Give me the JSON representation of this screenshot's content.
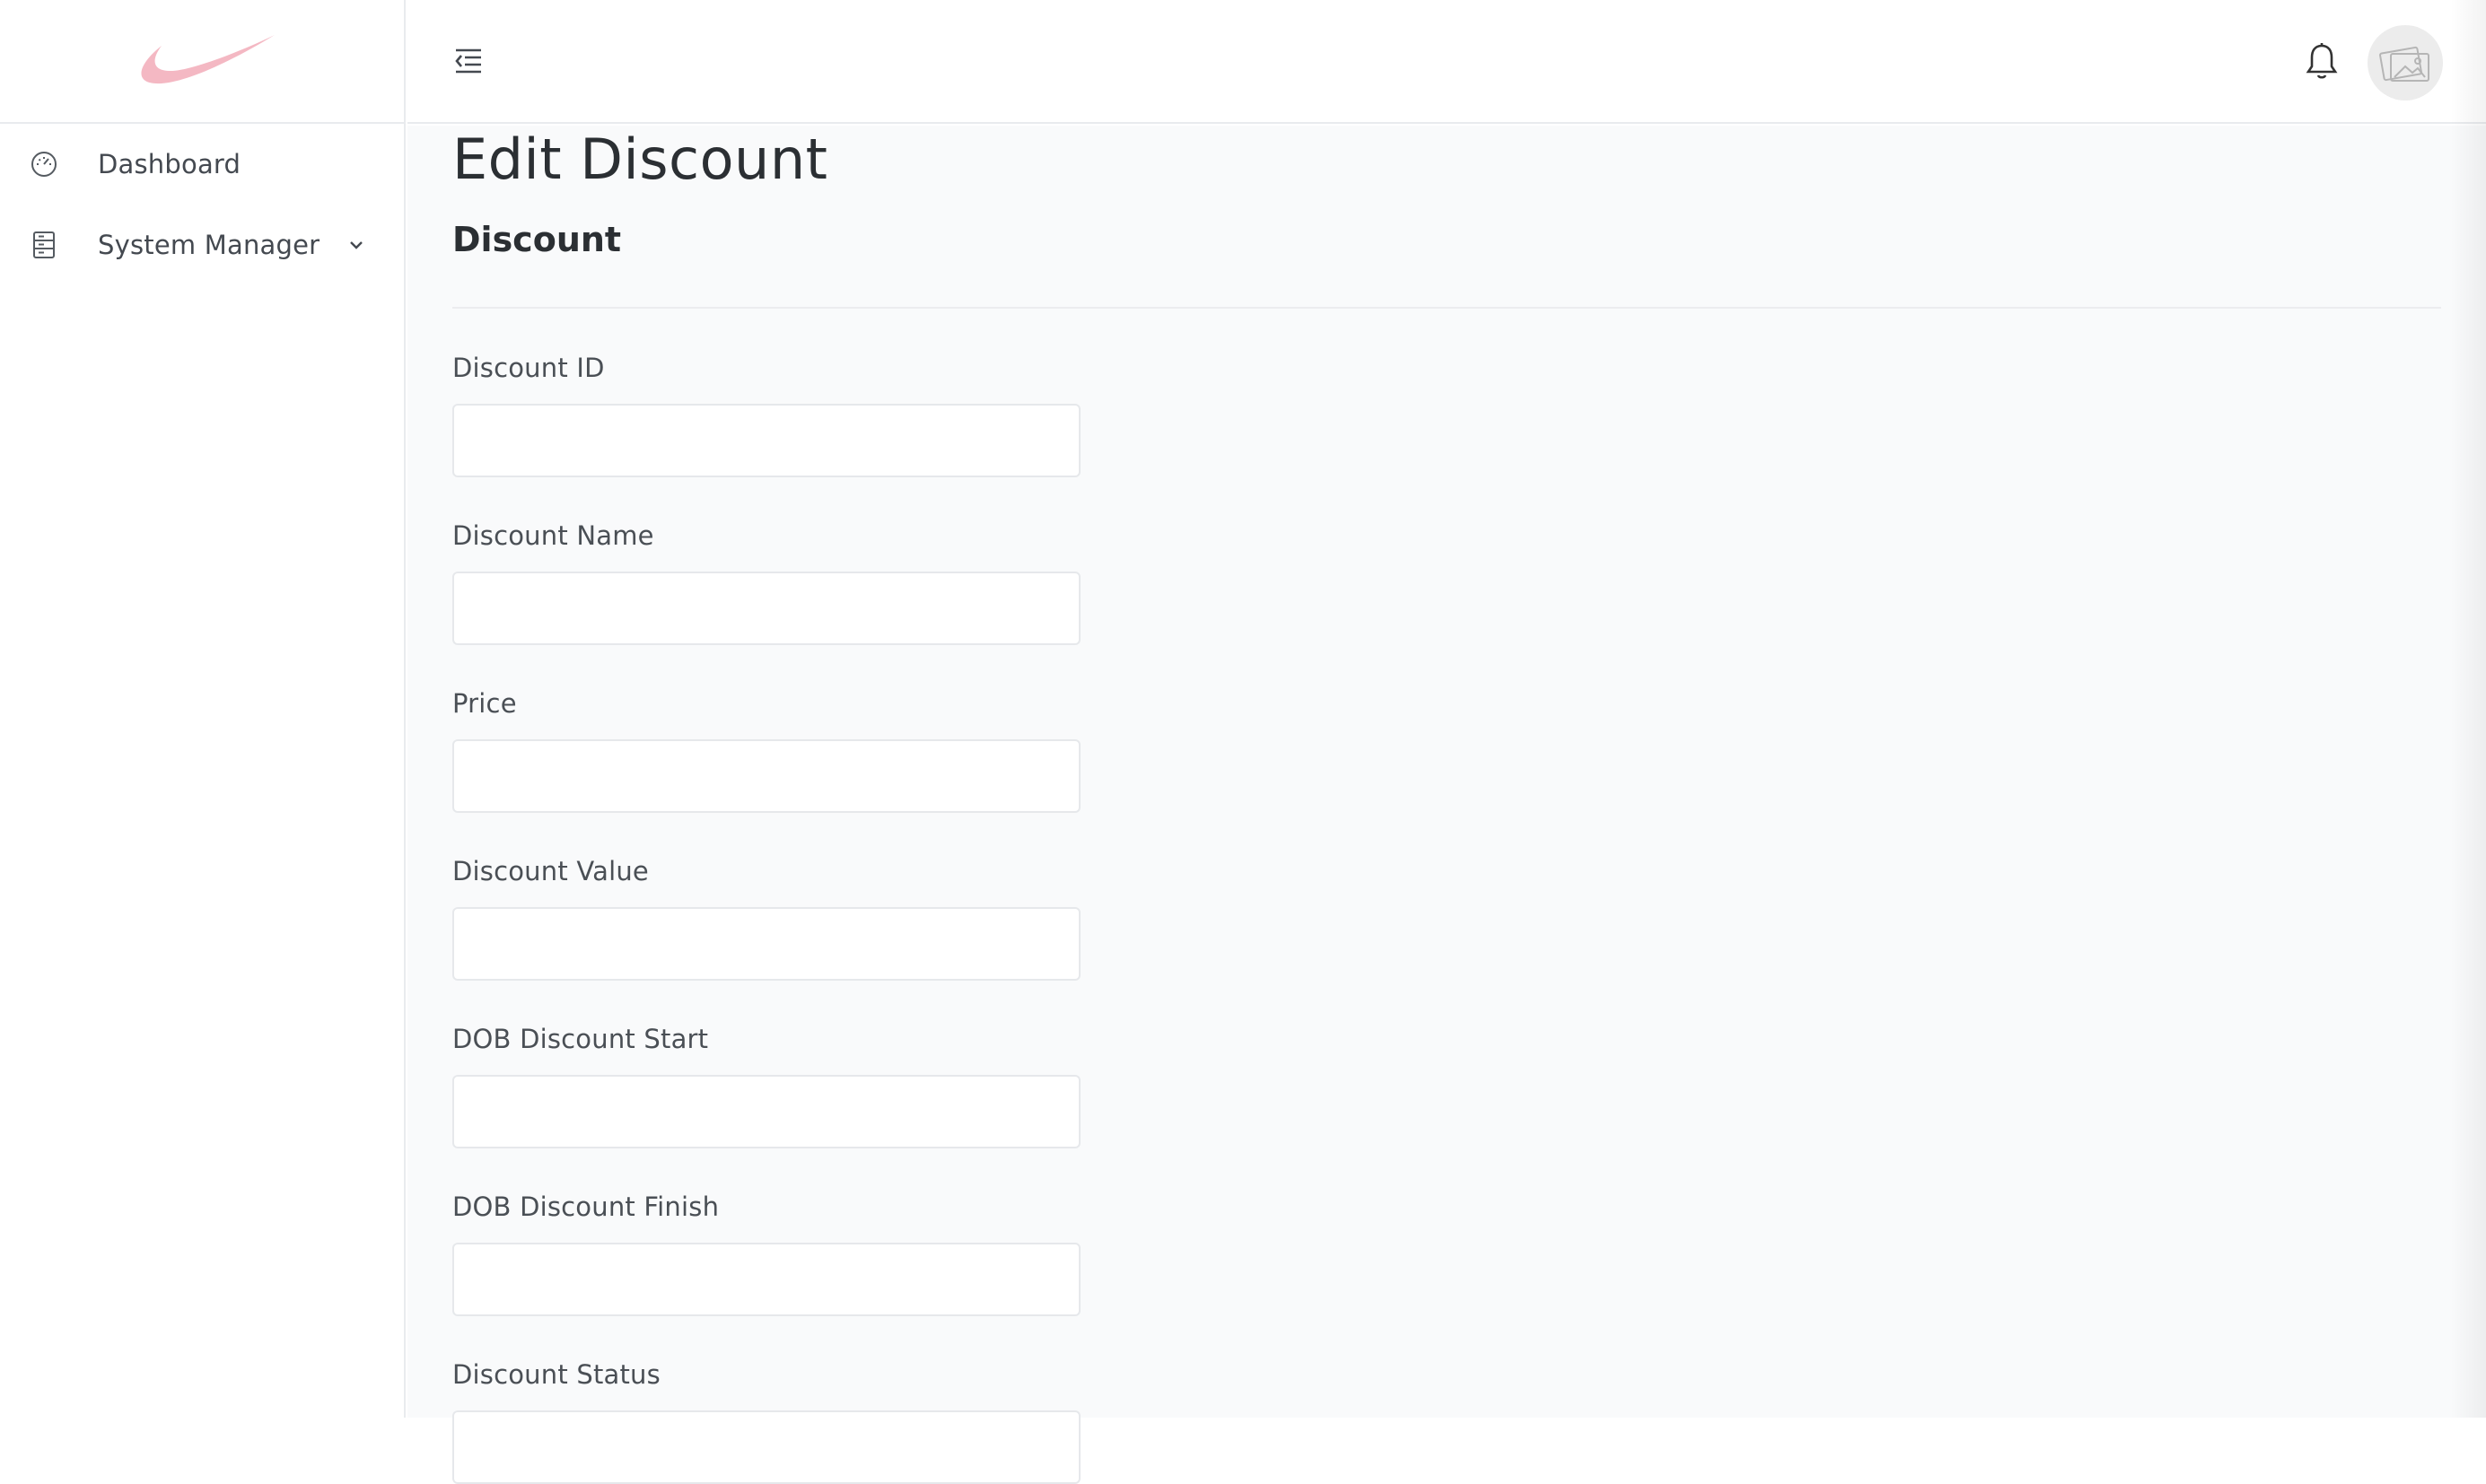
{
  "sidebar": {
    "items": [
      {
        "label": "Dashboard",
        "icon": "gauge-icon"
      },
      {
        "label": "System Manager",
        "icon": "server-icon"
      }
    ]
  },
  "colors": {
    "brand_logo": "#f4b8c3",
    "background": "#f9fafb"
  },
  "main": {
    "page_title": "Edit Discount",
    "section_title": "Discount",
    "fields": [
      {
        "label": "Discount ID",
        "value": ""
      },
      {
        "label": "Discount Name",
        "value": ""
      },
      {
        "label": "Price",
        "value": ""
      },
      {
        "label": "Discount Value",
        "value": ""
      },
      {
        "label": "DOB Discount Start",
        "value": ""
      },
      {
        "label": "DOB Discount Finish",
        "value": ""
      },
      {
        "label": "Discount Status",
        "value": ""
      }
    ]
  }
}
